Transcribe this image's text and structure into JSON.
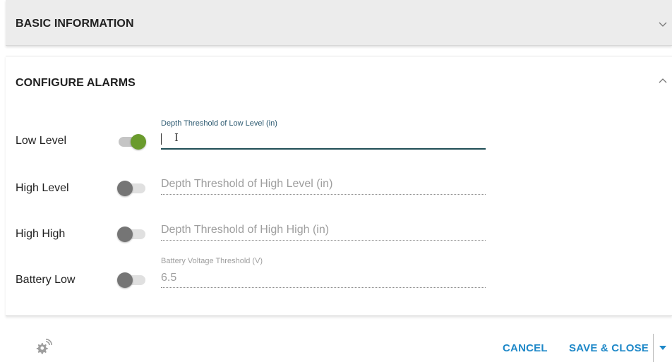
{
  "sections": {
    "basic": {
      "title": "BASIC INFORMATION"
    },
    "alarms": {
      "title": "CONFIGURE ALARMS"
    }
  },
  "alarms": [
    {
      "label": "Low Level",
      "enabled": true,
      "field_label": "Depth Threshold of Low Level (in)",
      "value": ""
    },
    {
      "label": "High Level",
      "enabled": false,
      "placeholder": "Depth Threshold of High Level (in)"
    },
    {
      "label": "High High",
      "enabled": false,
      "placeholder": "Depth Threshold of High High (in)"
    },
    {
      "label": "Battery Low",
      "enabled": false,
      "field_label": "Battery Voltage Threshold (V)",
      "value": "6.5"
    }
  ],
  "footer": {
    "cancel_label": "CANCEL",
    "save_label": "SAVE & CLOSE"
  },
  "icons": {
    "settings": "gear-wireless-icon",
    "collapse_down": "chevron-down-icon",
    "collapse_up": "chevron-up-icon",
    "dropdown": "caret-down-icon"
  },
  "colors": {
    "accent": "#1e88c8",
    "toggle_on": "#6a9b2d",
    "active_underline": "#1f4d55"
  }
}
